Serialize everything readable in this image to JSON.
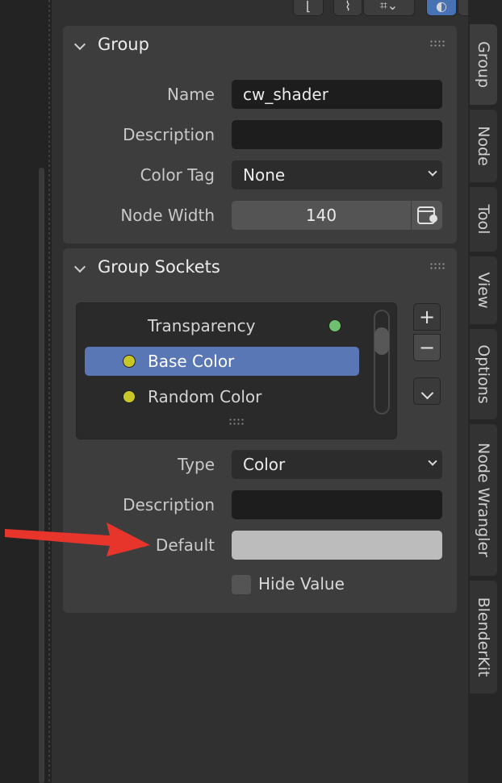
{
  "header": {
    "icons": [
      "selection-icon",
      "snap-icon",
      "snap-grid-icon",
      "overlay-icon"
    ]
  },
  "group_panel": {
    "title": "Group",
    "name_label": "Name",
    "name_value": "cw_shader",
    "description_label": "Description",
    "description_value": "",
    "color_tag_label": "Color Tag",
    "color_tag_value": "None",
    "node_width_label": "Node Width",
    "node_width_value": "140"
  },
  "sockets_panel": {
    "title": "Group Sockets",
    "items": [
      {
        "label": "Transparency",
        "socket_color": "#6fbf6f",
        "kind": "output"
      },
      {
        "label": "Base Color",
        "socket_color": "#c7c729",
        "kind": "input",
        "selected": true
      },
      {
        "label": "Random Color",
        "socket_color": "#c7c729",
        "kind": "input"
      }
    ],
    "add_label": "+",
    "remove_label": "−",
    "type_label": "Type",
    "type_value": "Color",
    "description_label": "Description",
    "description_value": "",
    "default_label": "Default",
    "default_color": "#bcbcbc",
    "hide_value_label": "Hide Value"
  },
  "sidebar_tabs": [
    {
      "label": "Group",
      "active": true
    },
    {
      "label": "Node"
    },
    {
      "label": "Tool"
    },
    {
      "label": "View"
    },
    {
      "label": "Options"
    },
    {
      "label": "Node Wrangler"
    },
    {
      "label": "BlenderKit"
    }
  ],
  "colors": {
    "accent": "#4772b3",
    "selection": "#5a77b5",
    "annotation_arrow": "#e8352b"
  }
}
